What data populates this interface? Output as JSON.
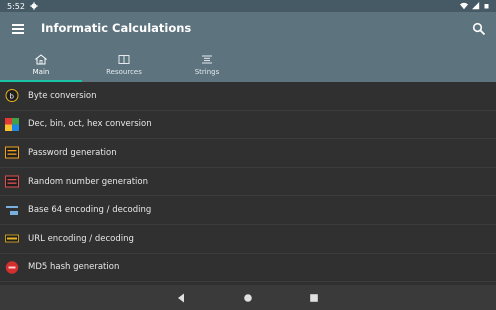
{
  "status_bar": {
    "time": "5:52"
  },
  "app_bar": {
    "title": "Informatic Calculations"
  },
  "tabs": [
    {
      "label": "Main",
      "icon": "home-icon",
      "selected": true
    },
    {
      "label": "Resources",
      "icon": "book-icon",
      "selected": false
    },
    {
      "label": "Strings",
      "icon": "strings-icon",
      "selected": false
    }
  ],
  "items": [
    {
      "label": "Byte conversion",
      "icon": "byte-icon"
    },
    {
      "label": "Dec, bin, oct, hex conversion",
      "icon": "number-base-icon"
    },
    {
      "label": "Password generation",
      "icon": "password-icon"
    },
    {
      "label": "Random number generation",
      "icon": "random-number-icon"
    },
    {
      "label": "Base 64 encoding / decoding",
      "icon": "base64-icon"
    },
    {
      "label": "URL encoding / decoding",
      "icon": "url-icon"
    },
    {
      "label": "MD5 hash generation",
      "icon": "md5-icon"
    }
  ],
  "colors": {
    "app_bar": "#5d737e",
    "status_bar": "#455a64",
    "tab_indicator": "#19c3a6",
    "background": "#303030"
  }
}
